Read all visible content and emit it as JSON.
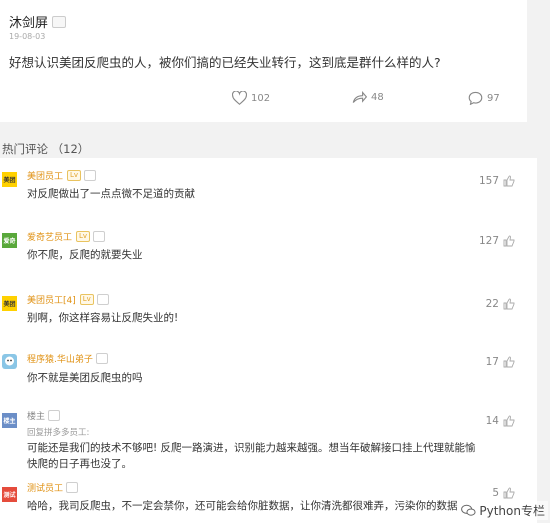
{
  "post": {
    "author": "沐剑屏",
    "badge": "",
    "date": "19-08-03",
    "text": "好想认识美团反爬虫的人，被你们搞的已经失业转行，这到底是群什么样的人?",
    "likes": "102",
    "shares": "48",
    "comments": "97"
  },
  "hot_comments": {
    "label": "热门评论",
    "count": "（12）"
  },
  "comments": [
    {
      "avatar_text": "美团",
      "avatar_color": "#ffd100",
      "user": "美团员工",
      "level": "Lv",
      "likes": "157",
      "text": "对反爬做出了一点点微不足道的贡献"
    },
    {
      "avatar_text": "爱奇",
      "avatar_color": "#59a83b",
      "user": "爱奇艺员工",
      "level": "Lv",
      "likes": "127",
      "text": "你不爬，反爬的就要失业"
    },
    {
      "avatar_text": "美团",
      "avatar_color": "#ffd100",
      "user": "美团员工[4]",
      "level": "Lv",
      "likes": "22",
      "text": "别啊，你这样容易让反爬失业的!"
    },
    {
      "avatar_text": "",
      "avatar_color": "#8ac6e6",
      "user": "程序猿.华山弟子",
      "level": "",
      "likes": "17",
      "text": "你不就是美团反爬虫的吗"
    },
    {
      "avatar_text": "楼主",
      "avatar_color": "#6b8ec7",
      "user": "楼主",
      "level": "",
      "likes": "14",
      "reply_to": "回复拼多多员工:",
      "text": "可能还是我们的技术不够吧! 反爬一路演进，识别能力越来越强。想当年破解接口挂上代理就能愉",
      "text2": "快爬的日子再也没了。"
    },
    {
      "avatar_text": "测试",
      "avatar_color": "#e54c3c",
      "user": "测试员工",
      "level": "",
      "likes": "5",
      "text": "哈哈，我司反爬虫，不一定会禁你，还可能会给你脏数据，让你清洗都很难弄，污染你的数据"
    }
  ],
  "watermark": "Python专栏"
}
